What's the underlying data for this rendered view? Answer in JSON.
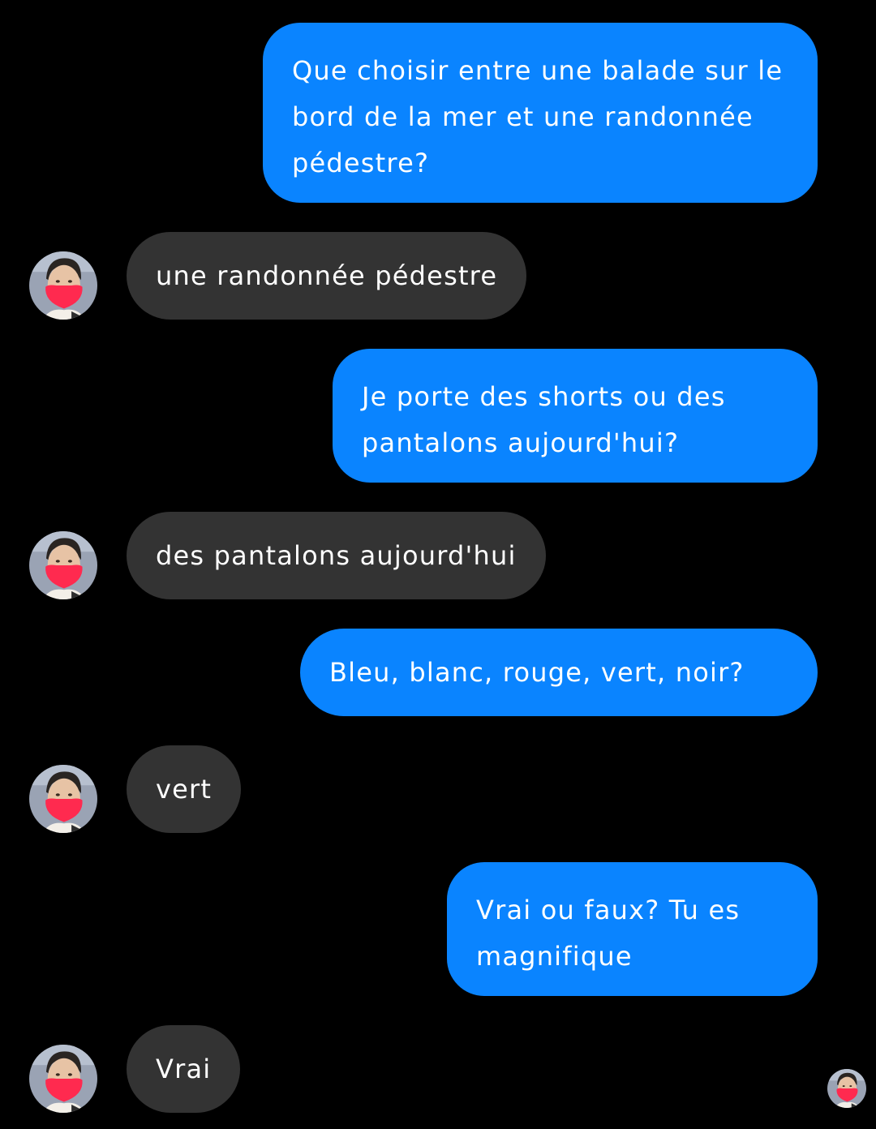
{
  "conversation": {
    "messages": [
      {
        "direction": "sent",
        "text": "Que choisir entre une balade sur le bord de la mer et une randonnée pédestre?"
      },
      {
        "direction": "received",
        "text": "une randonnée pédestre"
      },
      {
        "direction": "sent",
        "text": "Je porte des shorts ou des pantalons aujourd'hui?"
      },
      {
        "direction": "received",
        "text": "des pantalons aujourd'hui"
      },
      {
        "direction": "sent",
        "text": "Bleu, blanc, rouge, vert, noir?"
      },
      {
        "direction": "received",
        "text": "vert"
      },
      {
        "direction": "sent",
        "text": "Vrai ou faux? Tu es magnifique"
      },
      {
        "direction": "received",
        "text": "Vrai"
      }
    ],
    "avatar_icon": "masked-person-avatar-icon",
    "read_receipt_icon": "seen-avatar-icon"
  },
  "colors": {
    "background": "#000000",
    "sent_bubble": "#0a84ff",
    "received_bubble": "#333333",
    "text": "#ffffff",
    "mask": "#ff2a4f"
  }
}
